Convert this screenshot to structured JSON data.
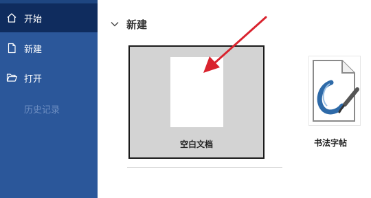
{
  "sidebar": {
    "items": [
      {
        "label": "开始",
        "icon": "home-icon",
        "active": true
      },
      {
        "label": "新建",
        "icon": "new-document-icon",
        "active": false
      },
      {
        "label": "打开",
        "icon": "open-folder-icon",
        "active": false
      },
      {
        "label": "历史记录",
        "icon": "",
        "active": false,
        "disabled": true
      }
    ]
  },
  "main": {
    "section_title": "新建",
    "templates": [
      {
        "label": "空白文档"
      },
      {
        "label": "书法字帖"
      }
    ]
  },
  "colors": {
    "sidebar_bg": "#2b579a",
    "sidebar_active": "#0f2c5e",
    "arrow": "#d9232e"
  }
}
